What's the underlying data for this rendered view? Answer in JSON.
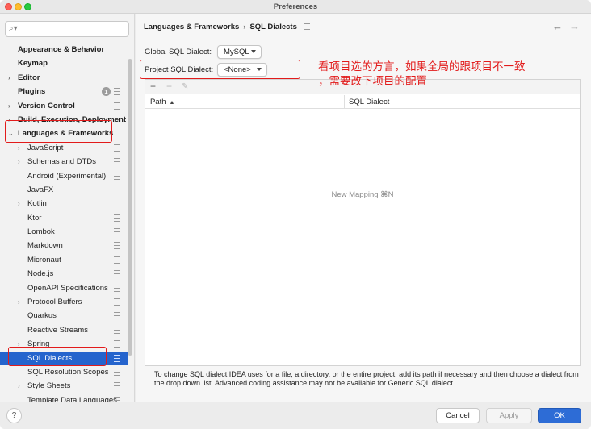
{
  "window": {
    "title": "Preferences"
  },
  "search": {
    "placeholder": "",
    "value": ""
  },
  "sidebar": {
    "items": [
      {
        "label": "Appearance & Behavior",
        "level": "top",
        "arrow": "",
        "gear": false
      },
      {
        "label": "Keymap",
        "level": "top",
        "arrow": "",
        "gear": false
      },
      {
        "label": "Editor",
        "level": "top",
        "arrow": "›",
        "gear": false
      },
      {
        "label": "Plugins",
        "level": "top",
        "arrow": "",
        "gear": true,
        "badge": "1"
      },
      {
        "label": "Version Control",
        "level": "top",
        "arrow": "›",
        "gear": true
      },
      {
        "label": "Build, Execution, Deployment",
        "level": "top",
        "arrow": "›",
        "gear": false
      },
      {
        "label": "Languages & Frameworks",
        "level": "top",
        "arrow": "⌄",
        "gear": false
      },
      {
        "label": "JavaScript",
        "level": "sub",
        "arrow": "›",
        "gear": true
      },
      {
        "label": "Schemas and DTDs",
        "level": "sub",
        "arrow": "›",
        "gear": true
      },
      {
        "label": "Android (Experimental)",
        "level": "sub",
        "arrow": "",
        "gear": true
      },
      {
        "label": "JavaFX",
        "level": "sub",
        "arrow": "",
        "gear": false
      },
      {
        "label": "Kotlin",
        "level": "sub",
        "arrow": "›",
        "gear": false
      },
      {
        "label": "Ktor",
        "level": "sub",
        "arrow": "",
        "gear": true
      },
      {
        "label": "Lombok",
        "level": "sub",
        "arrow": "",
        "gear": true
      },
      {
        "label": "Markdown",
        "level": "sub",
        "arrow": "",
        "gear": true
      },
      {
        "label": "Micronaut",
        "level": "sub",
        "arrow": "",
        "gear": true
      },
      {
        "label": "Node.js",
        "level": "sub",
        "arrow": "",
        "gear": true
      },
      {
        "label": "OpenAPI Specifications",
        "level": "sub",
        "arrow": "",
        "gear": true
      },
      {
        "label": "Protocol Buffers",
        "level": "sub",
        "arrow": "›",
        "gear": true
      },
      {
        "label": "Quarkus",
        "level": "sub",
        "arrow": "",
        "gear": true
      },
      {
        "label": "Reactive Streams",
        "level": "sub",
        "arrow": "",
        "gear": true
      },
      {
        "label": "Spring",
        "level": "sub",
        "arrow": "›",
        "gear": true
      },
      {
        "label": "SQL Dialects",
        "level": "sub",
        "arrow": "",
        "gear": true,
        "selected": true
      },
      {
        "label": "SQL Resolution Scopes",
        "level": "sub",
        "arrow": "",
        "gear": true
      },
      {
        "label": "Style Sheets",
        "level": "sub",
        "arrow": "›",
        "gear": true
      },
      {
        "label": "Template Data Languages",
        "level": "sub",
        "arrow": "",
        "gear": true
      }
    ]
  },
  "main": {
    "breadcrumb": {
      "parent": "Languages & Frameworks",
      "separator": "›",
      "current": "SQL Dialects"
    },
    "global_dialect": {
      "label": "Global SQL Dialect:",
      "value": "MySQL"
    },
    "project_dialect": {
      "label": "Project SQL Dialect:",
      "value": "<None>"
    },
    "table": {
      "columns": [
        "Path",
        "SQL Dialect"
      ],
      "sort_indicator": "▲",
      "empty_text": "New Mapping ⌘N"
    },
    "help_text": "To change SQL dialect IDEA uses for a file, a directory, or the entire project, add its path if necessary and then choose a dialect from the drop down list. Advanced coding assistance may not be available for Generic SQL dialect."
  },
  "footer": {
    "help_label": "?",
    "cancel_label": "Cancel",
    "apply_label": "Apply",
    "ok_label": "OK"
  },
  "annotation": {
    "line1": "看项目选的方言，如果全局的跟项目不一致",
    "line2": "，需要改下项目的配置",
    "color": "#e21b1b"
  },
  "colors": {
    "accent": "#2564cd",
    "ok_button": "#2d6cd6"
  }
}
